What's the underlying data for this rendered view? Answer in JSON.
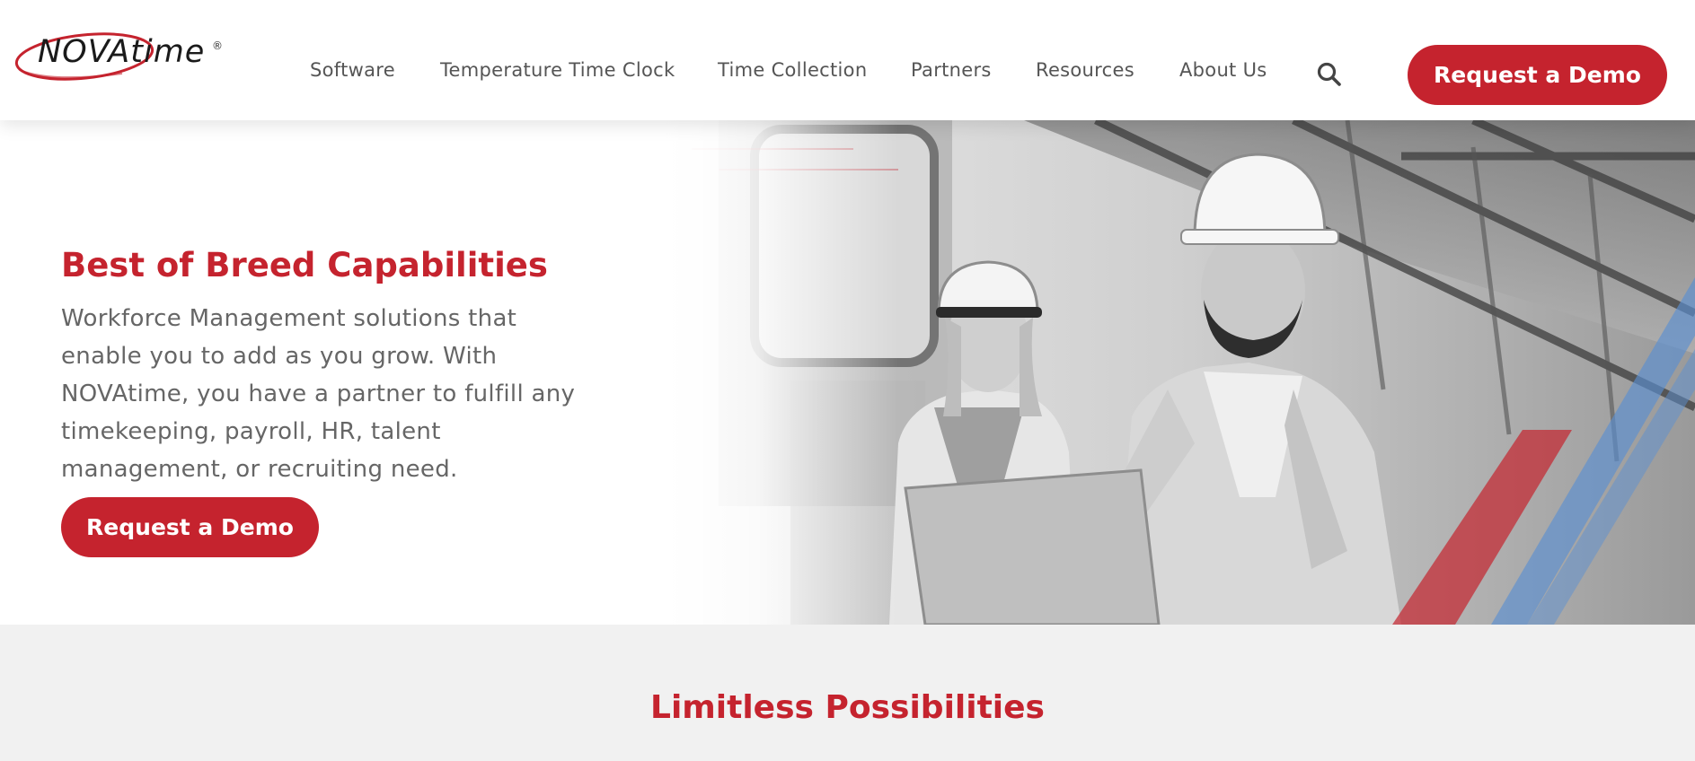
{
  "brand": {
    "logo_text": "NOVAtime",
    "logo_registered": "®",
    "accent_color": "#c5232e"
  },
  "nav": {
    "items": [
      {
        "label": "Software"
      },
      {
        "label": "Temperature Time Clock"
      },
      {
        "label": "Time Collection"
      },
      {
        "label": "Partners"
      },
      {
        "label": "Resources"
      },
      {
        "label": "About Us"
      }
    ],
    "search_icon": "search-icon",
    "cta_label": "Request a Demo"
  },
  "hero": {
    "title": "Best of Breed Capabilities",
    "description": "Workforce Management solutions that enable you to add as you grow. With NOVAtime, you have a partner to fulfill any timekeeping, payroll, HR, talent management, or recruiting need.",
    "cta_label": "Request a Demo",
    "image": "workers-with-laptop-photo"
  },
  "section": {
    "title": "Limitless Possibilities"
  }
}
